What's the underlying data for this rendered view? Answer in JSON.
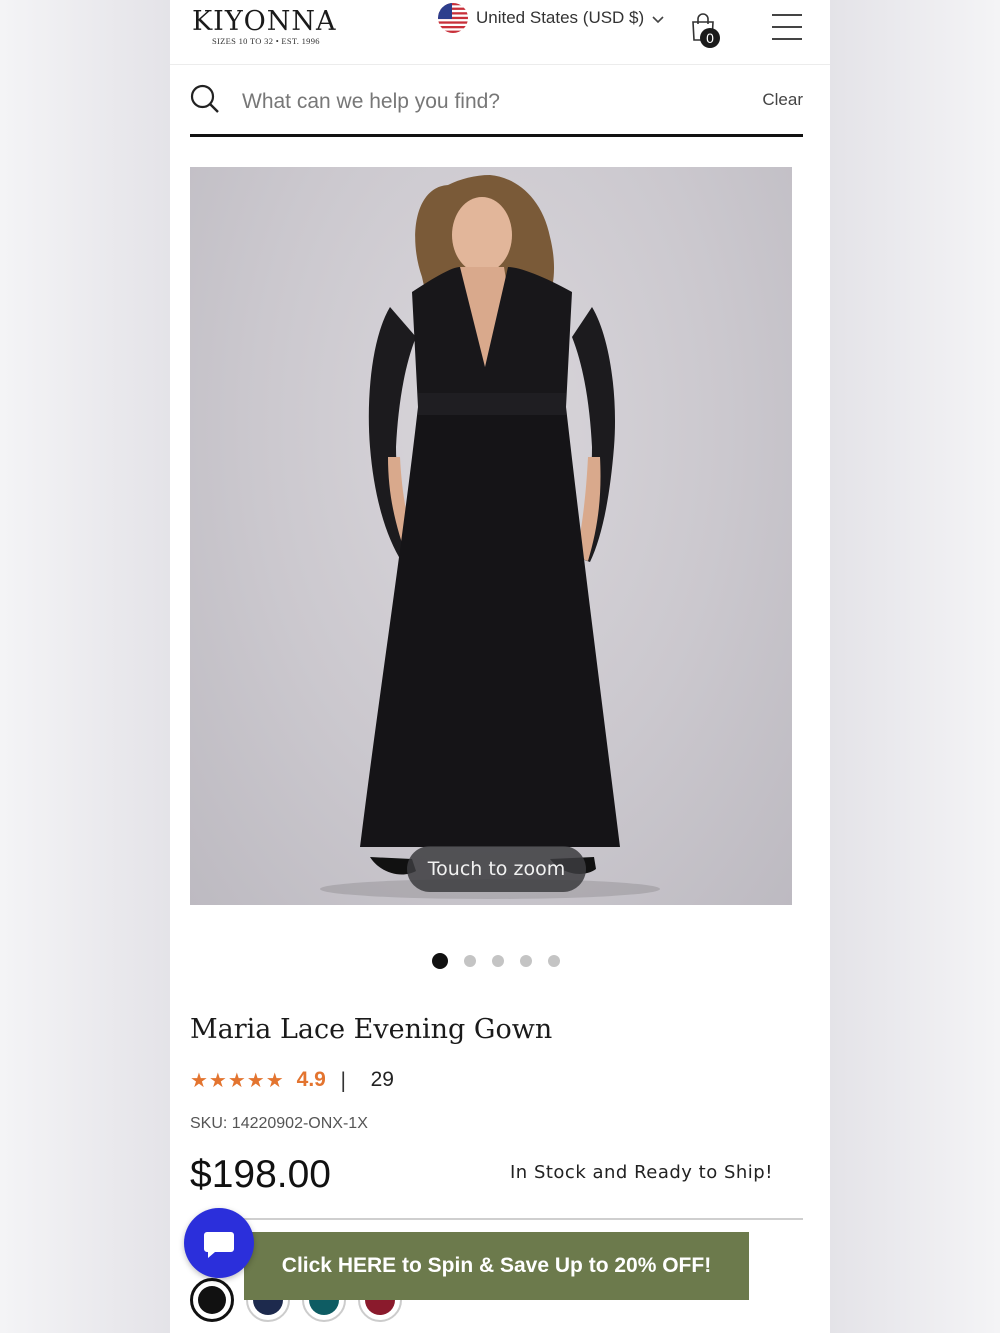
{
  "header": {
    "logo_text": "KIYONNA",
    "logo_tagline": "SIZES 10 TO 32  •  EST. 1996",
    "locale_label": "United States (USD $)",
    "cart_count": "0"
  },
  "search": {
    "placeholder": "What can we help you find?",
    "clear_label": "Clear"
  },
  "gallery": {
    "zoom_hint": "Touch to zoom",
    "slide_count": 5,
    "active_slide": 1
  },
  "product": {
    "title": "Maria Lace Evening Gown",
    "stars": "★★★★★",
    "rating": "4.9",
    "rating_separator": "|",
    "review_count": "29",
    "sku": "SKU: 14220902-ONX-1X",
    "price": "$198.00",
    "stock_status": "In Stock and Ready to Ship!",
    "swatch_colors": [
      "#111111",
      "#1d2a4d",
      "#0e5c63",
      "#8a1a2c"
    ]
  },
  "promo": {
    "spin_banner": "Click HERE to Spin & Save Up to 20% OFF!"
  },
  "colors": {
    "accent_orange": "#e3742f",
    "promo_green": "#6c7a4c",
    "chat_blue": "#2b2fdb"
  },
  "icons": {
    "search": "search-icon",
    "bag": "shopping-bag-icon",
    "menu": "hamburger-menu-icon",
    "chat": "chat-bubble-icon",
    "flag": "us-flag-icon",
    "chevron": "chevron-down-icon"
  }
}
